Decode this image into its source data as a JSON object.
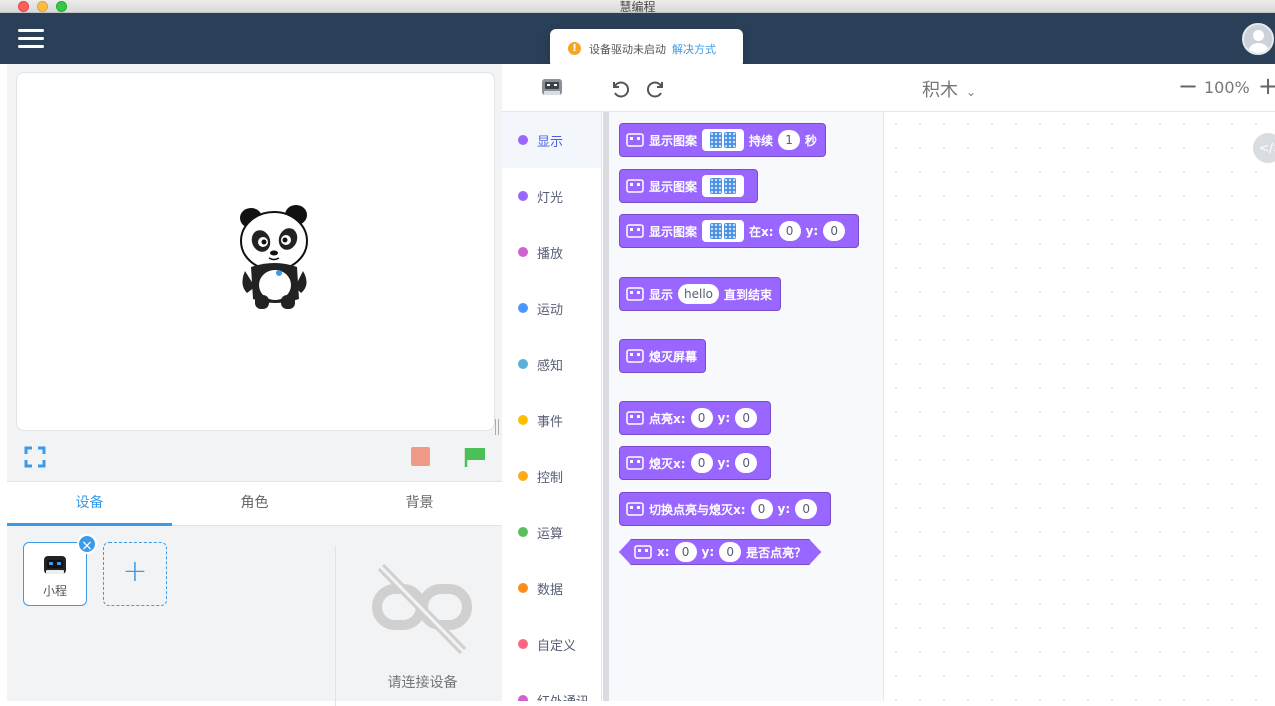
{
  "window": {
    "title": "慧编程"
  },
  "toast": {
    "message": "设备驱动未启动",
    "fix_link": "解决方式"
  },
  "stage": {
    "tabs": [
      {
        "label": "设备"
      },
      {
        "label": "角色"
      },
      {
        "label": "背景"
      }
    ],
    "active_tab": "设备",
    "device": {
      "name": "小程",
      "remove_label": "×"
    },
    "add_label": "+",
    "not_connected_text": "请连接设备"
  },
  "toolbar": {
    "mode_label": "积木",
    "zoom_label": "100%",
    "zoom_out_label": "−",
    "zoom_in_label": "+"
  },
  "workspace": {
    "code_toggle_label": "</>"
  },
  "categories": [
    {
      "label": "显示",
      "color": "#9966ff"
    },
    {
      "label": "灯光",
      "color": "#9966ff"
    },
    {
      "label": "播放",
      "color": "#cf63cf"
    },
    {
      "label": "运动",
      "color": "#4c97ff"
    },
    {
      "label": "感知",
      "color": "#5cb1d6"
    },
    {
      "label": "事件",
      "color": "#ffbf00"
    },
    {
      "label": "控制",
      "color": "#ffab19"
    },
    {
      "label": "运算",
      "color": "#59c059"
    },
    {
      "label": "数据",
      "color": "#ff8c1a"
    },
    {
      "label": "自定义",
      "color": "#ff6680"
    },
    {
      "label": "红外通讯",
      "color": "#cf63cf"
    }
  ],
  "blocks": {
    "b1": {
      "t1": "显示图案",
      "t2": "持续",
      "v1": "1",
      "t3": "秒"
    },
    "b2": {
      "t1": "显示图案"
    },
    "b3": {
      "t1": "显示图案",
      "t2": "在x:",
      "v1": "0",
      "t3": "y:",
      "v2": "0"
    },
    "b4": {
      "t1": "显示",
      "v1": "hello",
      "t2": "直到结束"
    },
    "b5": {
      "t1": "熄灭屏幕"
    },
    "b6": {
      "t1": "点亮x:",
      "v1": "0",
      "t2": "y:",
      "v2": "0"
    },
    "b7": {
      "t1": "熄灭x:",
      "v1": "0",
      "t2": "y:",
      "v2": "0"
    },
    "b8": {
      "t1": "切换点亮与熄灭x:",
      "v1": "0",
      "t2": "y:",
      "v2": "0"
    },
    "b9": {
      "t1": "x:",
      "v1": "0",
      "t2": "y:",
      "v2": "0",
      "t3": "是否点亮？"
    }
  }
}
